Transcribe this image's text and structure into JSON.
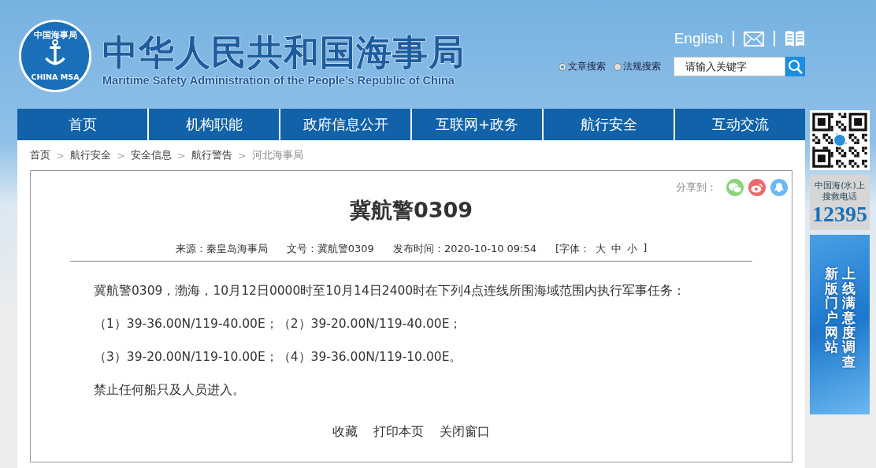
{
  "header": {
    "logo": {
      "ring_text": "中国海事局",
      "bottom_text": "CHINA MSA"
    },
    "title": "中华人民共和国海事局",
    "subtitle": "Maritime Safety Administration of the People’s Republic of China",
    "english_link": "English",
    "search_scopes": [
      {
        "label": "文章搜索",
        "selected": true
      },
      {
        "label": "法规搜索",
        "selected": false
      }
    ],
    "search": {
      "placeholder": "请输入关键字"
    }
  },
  "nav": [
    "首页",
    "机构职能",
    "政府信息公开",
    "互联网+政务",
    "航行安全",
    "互动交流"
  ],
  "breadcrumb": [
    "首页",
    "航行安全",
    "安全信息",
    "航行警告",
    "河北海事局"
  ],
  "breadcrumb_separator": ">",
  "article": {
    "share_label": "分享到：",
    "title": "冀航警0309",
    "meta": {
      "source": "来源：秦皇岛海事局",
      "number": "文号：冀航警0309",
      "published": "发布时间：2020-10-10 09:54",
      "font_label": "[字体：",
      "font_sizes": [
        "大",
        "中",
        "小"
      ],
      "font_close": "]"
    },
    "paragraphs": [
      "冀航警0309，渤海，10月12日0000时至10月14日2400时在下列4点连线所围海域范围内执行军事任务：",
      "（1）39-36.00N/119-40.00E；（2）39-20.00N/119-40.00E；",
      "（3）39-20.00N/119-10.00E；（4）39-36.00N/119-10.00E。",
      "禁止任何船只及人员进入。"
    ],
    "actions": [
      "收藏",
      "打印本页",
      "关闭窗口"
    ]
  },
  "sidebar": {
    "hotline_label": [
      "中国海(水)上",
      "搜救电话"
    ],
    "hotline_number": "12395",
    "banner": [
      "新版门户网站",
      "上线满意度调查"
    ]
  }
}
